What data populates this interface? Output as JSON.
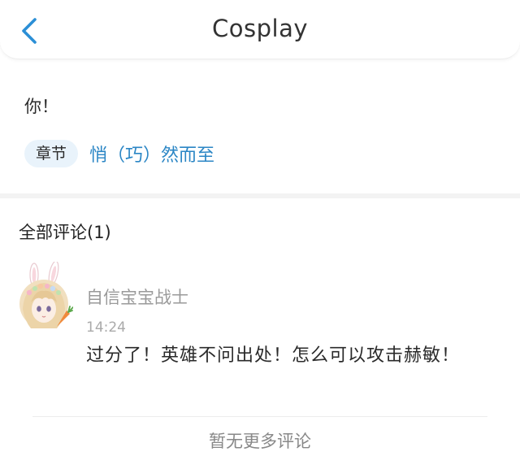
{
  "header": {
    "title": "Cosplay",
    "back_icon": "chevron-left-icon",
    "accent_color": "#2b8fd6"
  },
  "post": {
    "text": "你！",
    "chapter_label": "章节",
    "chapter_link": "悄（巧）然而至"
  },
  "comments": {
    "heading": "全部评论(1)",
    "items": [
      {
        "user": "自信宝宝战士",
        "time": "14:24",
        "text": "过分了！英雄不问出处！怎么可以攻击赫敏！"
      }
    ],
    "no_more": "暂无更多评论"
  }
}
